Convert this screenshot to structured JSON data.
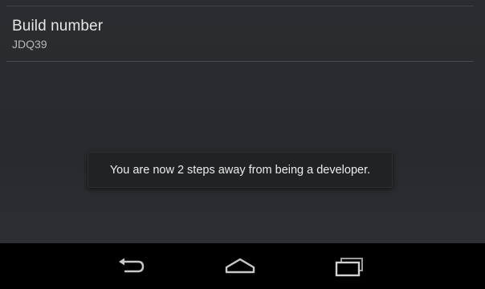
{
  "settings": {
    "build_number": {
      "title": "Build number",
      "summary": "JDQ39"
    }
  },
  "toast": {
    "message": "You are now 2 steps away from being a developer."
  },
  "navigation_bar": {
    "buttons": [
      {
        "icon": "back-icon"
      },
      {
        "icon": "home-icon"
      },
      {
        "icon": "recent-apps-icon"
      }
    ]
  },
  "colors": {
    "background": "#2a2c2f",
    "text_primary": "#e6e6e6",
    "text_secondary": "#b5b7b9",
    "toast_background": "#202224",
    "navbar_background": "#000000",
    "nav_icon": "#c8c8c8"
  }
}
